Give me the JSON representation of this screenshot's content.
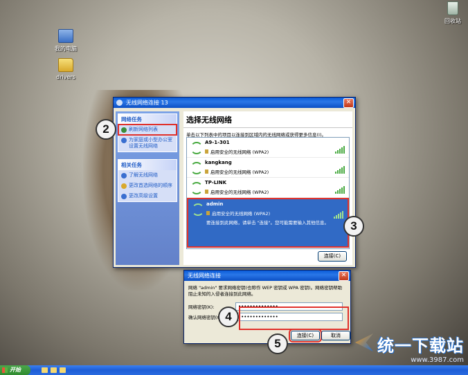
{
  "desktop": {
    "icons": [
      {
        "label": "我的电脑"
      },
      {
        "label": "drivers"
      },
      {
        "label": "回收站"
      }
    ]
  },
  "main_window": {
    "title": "无线网络连接 13",
    "sidebar": {
      "network_tasks_header": "网络任务",
      "refresh_label": "刷新网络列表",
      "setup_label": "为家庭或小型办公室设置无线网络",
      "related_tasks_header": "相关任务",
      "related": [
        {
          "label": "了解无线网络"
        },
        {
          "label": "更改首选网络的顺序"
        },
        {
          "label": "更改高级设置"
        }
      ]
    },
    "content": {
      "heading": "选择无线网络",
      "description": "单击以下列表中的项目以连接到区域内的无线网络或获得更多信息(I)。",
      "networks": [
        {
          "name": "A9-1-301",
          "security": "启用安全的无线网络 (WPA2)"
        },
        {
          "name": "kangkang",
          "security": "启用安全的无线网络 (WPA2)"
        },
        {
          "name": "TP-LINK",
          "security": "启用安全的无线网络 (WPA2)"
        }
      ],
      "selected_network": {
        "name": "admin",
        "security": "启用安全的无线网络 (WPA2)",
        "hint": "要连接到此网络，请单击 \"连接\"。您可能需要输入其他信息。"
      },
      "connect_button": "连接(C)"
    }
  },
  "dialog": {
    "title": "无线网络连接",
    "message": "网络 \"admin\" 要求网络密钥(也称作 WEP 密钥或 WPA 密钥)。网络密钥帮助阻止未知的入侵者连接到此网络。",
    "key_label": "网络密钥(K):",
    "key_value": "••••••••••••••",
    "confirm_label": "确认网络密钥(O):",
    "confirm_value": "••••••••••••••",
    "connect_button": "连接(C)",
    "cancel_button": "取消"
  },
  "steps": [
    "2",
    "3",
    "4",
    "5"
  ],
  "taskbar": {
    "start_label": "开始"
  },
  "watermark": {
    "brand": "统一下载站",
    "url": "www.3987.com"
  },
  "colors": {
    "title_blue": "#0a5bd8",
    "highlight_red": "#e0302a",
    "selected_row": "#316ac5"
  }
}
